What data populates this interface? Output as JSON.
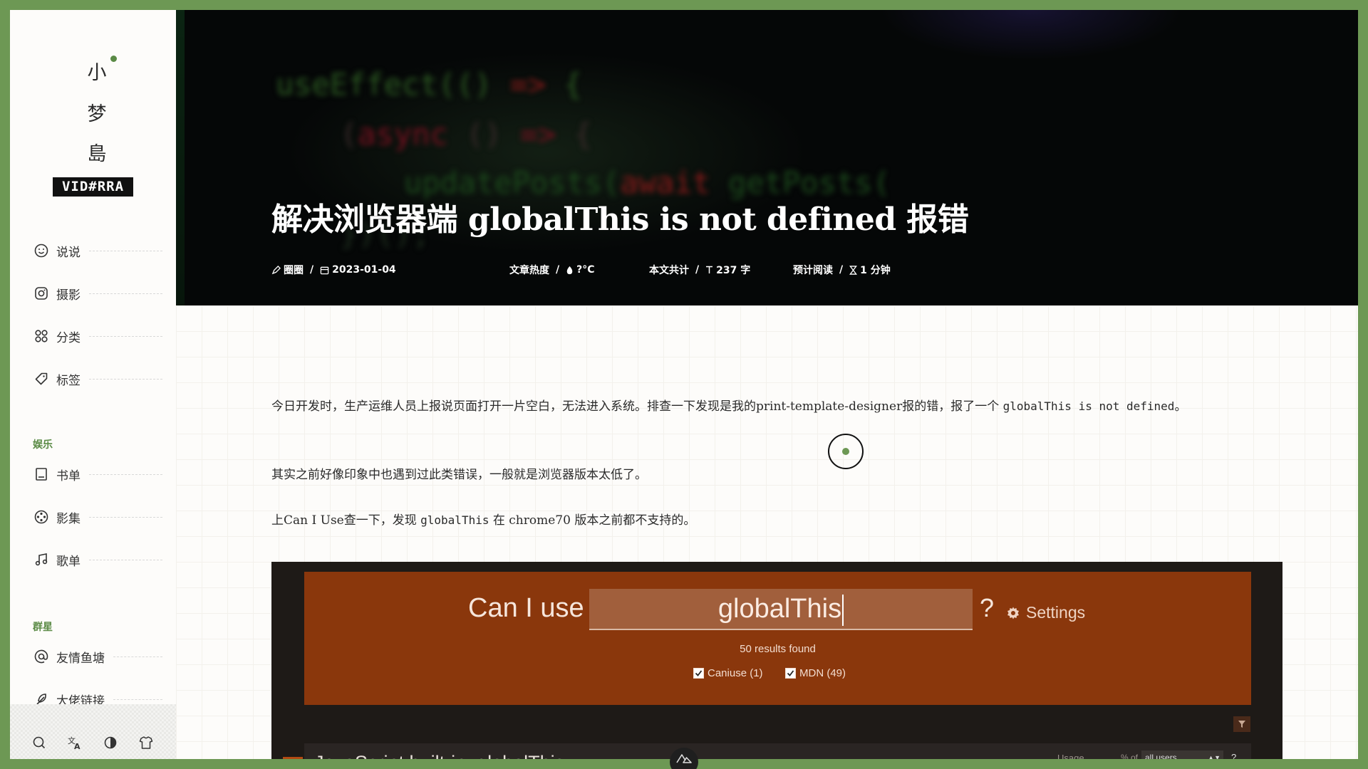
{
  "logo": {
    "chars": [
      "小",
      "梦",
      "島"
    ],
    "badge": "VID#RRA"
  },
  "nav": {
    "main": [
      {
        "label": "说说",
        "icon": "smile-icon"
      },
      {
        "label": "摄影",
        "icon": "instagram-icon"
      },
      {
        "label": "分类",
        "icon": "grid-icon"
      },
      {
        "label": "标签",
        "icon": "tag-icon"
      }
    ],
    "entertainment_title": "娱乐",
    "entertainment": [
      {
        "label": "书单",
        "icon": "book-icon"
      },
      {
        "label": "影集",
        "icon": "film-reel-icon"
      },
      {
        "label": "歌单",
        "icon": "music-icon"
      }
    ],
    "stars_title": "群星",
    "stars": [
      {
        "label": "友情鱼塘",
        "icon": "at-icon"
      },
      {
        "label": "大佬链接",
        "icon": "feather-icon"
      }
    ]
  },
  "toolbar": {
    "icons": [
      "search-icon",
      "translate-icon",
      "contrast-icon",
      "shirt-icon"
    ]
  },
  "hero": {
    "title": "解决浏览器端 globalThis is not defined 报错",
    "author": "圈圈",
    "date": "2023-01-04",
    "heat_label": "文章热度",
    "heat_value": "?°C",
    "words_label": "本文共计",
    "words_value": "237 字",
    "read_label": "预计阅读",
    "read_value": "1 分钟"
  },
  "article": {
    "p1_text": "今日开发时，生产运维人员上报说页面打开一片空白，无法进入系统。排查一下发现是我的print-template-designer报的错，报了一个 ",
    "p1_code": "globalThis is not defined",
    "p1_end": "。",
    "p2": "其实之前好像印象中也遇到过此类错误，一般就是浏览器版本太低了。",
    "p3_a": "上Can I Use查一下，发现 ",
    "p3_code": "globalThis",
    "p3_b": " 在 chrome70 版本之前都不支持的。"
  },
  "caniuse": {
    "can_i_use": "Can I use",
    "query": "globalThis",
    "question": "?",
    "settings": "Settings",
    "results": "50 results found",
    "check_caniuse": "Caniuse (1)",
    "check_mdn": "MDN (49)",
    "row_hash": "#",
    "row_title": "JavaScript built-in: globalThis",
    "usage": "Usage",
    "percent_of": "% of",
    "users_select": "all users",
    "help": "?"
  },
  "colors": {
    "accent": "#5a8a45",
    "border": "#6d9854",
    "caniuse_header": "#8a370c"
  }
}
